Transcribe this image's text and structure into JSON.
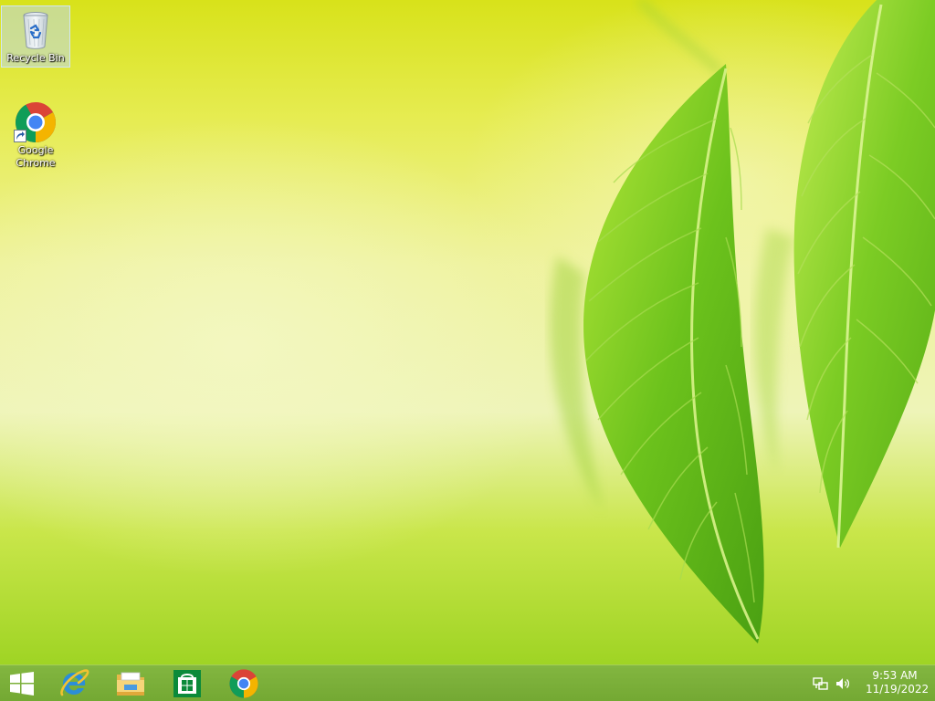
{
  "desktop": {
    "icons": [
      {
        "label": "Recycle Bin",
        "icon": "recycle-bin-icon",
        "selected": true
      },
      {
        "label": "Google Chrome",
        "icon": "chrome-icon",
        "shortcut": true
      }
    ]
  },
  "taskbar": {
    "start": {
      "icon": "windows-logo-icon"
    },
    "pinned": [
      {
        "icon": "internet-explorer-icon"
      },
      {
        "icon": "file-explorer-icon"
      },
      {
        "icon": "windows-store-icon"
      },
      {
        "icon": "chrome-icon"
      }
    ],
    "tray": {
      "icons": [
        "network-icon",
        "volume-icon"
      ],
      "time": "9:53 AM",
      "date": "11/19/2022"
    }
  },
  "colors": {
    "taskbar": "#78b030",
    "wallpaper_top": "#d8e21a",
    "wallpaper_bottom": "#9fd424",
    "leaf": "#6cc21c"
  }
}
